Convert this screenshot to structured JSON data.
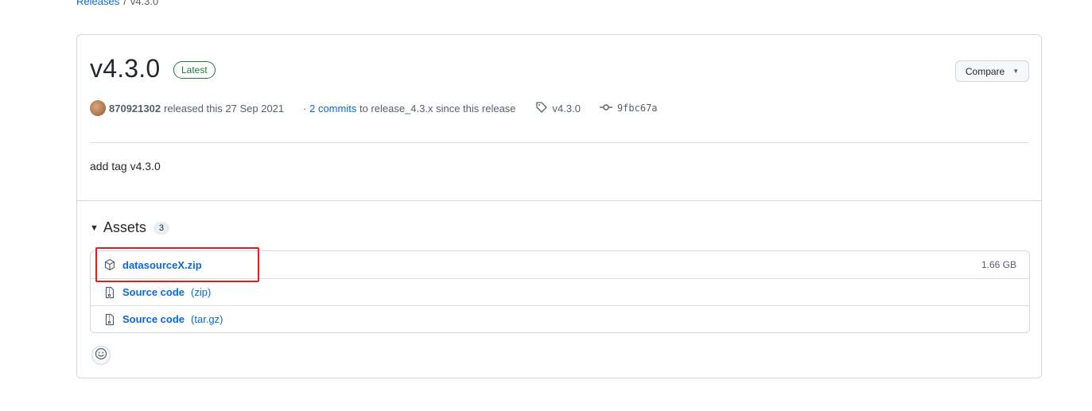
{
  "breadcrumb": {
    "parent": "Releases",
    "separator": "/",
    "current": "v4.3.0"
  },
  "release": {
    "title": "v4.3.0",
    "badge": "Latest",
    "compare_label": "Compare",
    "author": "870921302",
    "released_text": "released this 27 Sep 2021",
    "commits_prefix": "·",
    "commits_link": "2 commits",
    "commits_suffix": "to release_4.3.x since this release",
    "tag": "v4.3.0",
    "commit_sha": "9fbc67a",
    "body": "add tag v4.3.0"
  },
  "assets": {
    "heading": "Assets",
    "count": "3",
    "items": [
      {
        "icon": "package-icon",
        "name": "datasourceX.zip",
        "ext": "",
        "size": "1.66 GB"
      },
      {
        "icon": "file-zip-icon",
        "name": "Source code",
        "ext": "(zip)",
        "size": ""
      },
      {
        "icon": "file-zip-icon",
        "name": "Source code",
        "ext": "(tar.gz)",
        "size": ""
      }
    ]
  },
  "colors": {
    "accent": "#0969da",
    "latest_green": "#1a7f37",
    "highlight": "#e31e1e"
  }
}
